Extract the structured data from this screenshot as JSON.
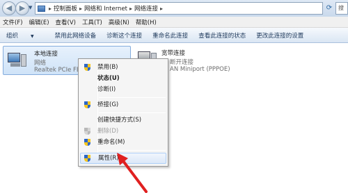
{
  "address_bar": {
    "breadcrumbs": [
      "控制面板",
      "网络和 Internet",
      "网络连接"
    ],
    "search_placeholder": "搜"
  },
  "menu": [
    "文件(F)",
    "编辑(E)",
    "查看(V)",
    "工具(T)",
    "高级(N)",
    "帮助(H)"
  ],
  "toolbar": {
    "organize": "组织",
    "disable": "禁用此网络设备",
    "diagnose": "诊断这个连接",
    "rename": "重命名此连接",
    "view_status": "查看此连接的状态",
    "change_settings": "更改此连接的设置"
  },
  "connections": [
    {
      "name": "本地连接",
      "type": "网络",
      "device": "Realtek PCIe FE"
    },
    {
      "name": "宽带连接",
      "type": "已断开连接",
      "device": "WAN Miniport (PPPOE)"
    }
  ],
  "visible_partial": {
    "conn2_type": "断开连接",
    "conn2_device": "AN Miniport (PPPOE)"
  },
  "context_menu": [
    {
      "label": "禁用(B)"
    },
    {
      "label": "状态(U)"
    },
    {
      "label": "诊断(I)"
    },
    {
      "label": "桥接(G)"
    },
    {
      "label": "创建快捷方式(S)"
    },
    {
      "label": "删除(D)"
    },
    {
      "label": "重命名(M)"
    },
    {
      "label": "属性(R)"
    }
  ],
  "colors": {
    "selection": "#cfe3f8",
    "toolbar_text": "#1e395b",
    "arrow": "#e02020"
  }
}
